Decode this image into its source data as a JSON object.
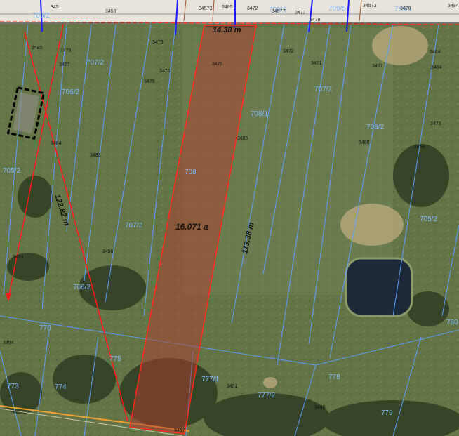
{
  "map": {
    "area_label": "16.071 a",
    "dimensions": {
      "top_width": "14.30 m",
      "east_length": "113.38 m",
      "west_length": "122.82 m"
    },
    "parcels": [
      "709/2",
      "709/3",
      "709/5",
      "709/1",
      "707/2",
      "706/2",
      "707/2",
      "708/1",
      "708/2",
      "708",
      "707/2",
      "706/2",
      "776",
      "775",
      "774",
      "773",
      "777/1",
      "777/2",
      "778",
      "779",
      "780",
      "705/2",
      "705/2"
    ],
    "points": [
      "3485",
      "3476",
      "3477",
      "3478",
      "3475",
      "3476",
      "3475",
      "3472",
      "3471",
      "3467",
      "3464",
      "3484",
      "3483",
      "3485",
      "3480",
      "3458",
      "3456",
      "3459",
      "3454",
      "3451",
      "3448",
      "3457",
      "3473",
      "3484"
    ],
    "top_strip_labels": [
      "345",
      "3456",
      "34573",
      "3485",
      "3472",
      "34577",
      "3473",
      "3479",
      "34573",
      "3478",
      "3484"
    ]
  },
  "colors": {
    "parcel_fill": "#b03a2e",
    "parcel_stroke": "#ff2a1a",
    "cadastral_lines": "#5aa0ff",
    "survey_line": "#ff1a1a",
    "road_strip": "#e8e4da",
    "building": "#000000"
  }
}
